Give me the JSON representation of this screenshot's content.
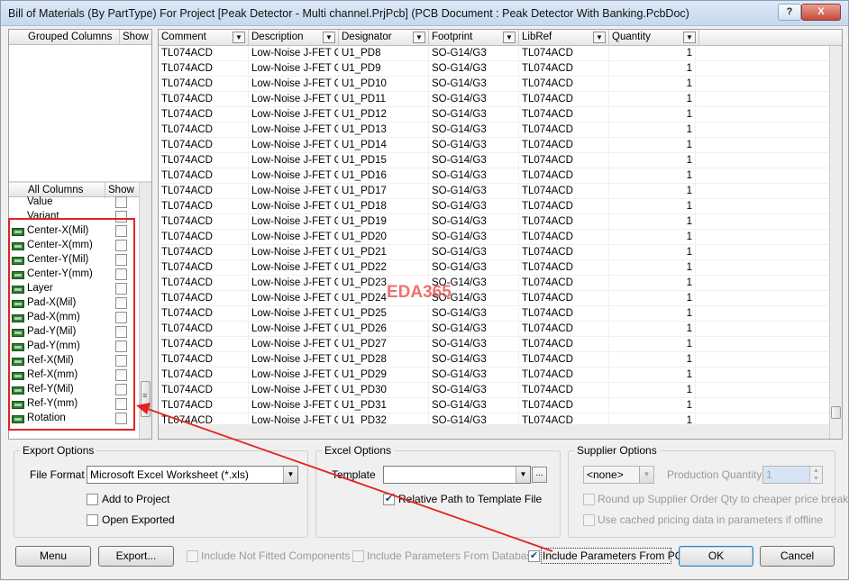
{
  "window": {
    "title": "Bill of Materials (By PartType) For Project [Peak Detector - Multi channel.PrjPcb] (PCB Document : Peak Detector With Banking.PcbDoc)",
    "help_label": "?",
    "close_label": "X"
  },
  "grouped_columns": {
    "headers": [
      "Grouped Columns",
      "Show"
    ]
  },
  "all_columns": {
    "headers": [
      "All Columns",
      "Show"
    ],
    "items": [
      {
        "label": "Value",
        "icon": "none",
        "checked": false
      },
      {
        "label": "Variant",
        "icon": "none",
        "checked": false
      },
      {
        "label": "Center-X(Mil)",
        "icon": "pcb-param-icon",
        "checked": false
      },
      {
        "label": "Center-X(mm)",
        "icon": "pcb-param-icon",
        "checked": false
      },
      {
        "label": "Center-Y(Mil)",
        "icon": "pcb-param-icon",
        "checked": false
      },
      {
        "label": "Center-Y(mm)",
        "icon": "pcb-param-icon",
        "checked": false
      },
      {
        "label": "Layer",
        "icon": "pcb-param-icon",
        "checked": false
      },
      {
        "label": "Pad-X(Mil)",
        "icon": "pcb-param-icon",
        "checked": false
      },
      {
        "label": "Pad-X(mm)",
        "icon": "pcb-param-icon",
        "checked": false
      },
      {
        "label": "Pad-Y(Mil)",
        "icon": "pcb-param-icon",
        "checked": false
      },
      {
        "label": "Pad-Y(mm)",
        "icon": "pcb-param-icon",
        "checked": false
      },
      {
        "label": "Ref-X(Mil)",
        "icon": "pcb-param-icon",
        "checked": false
      },
      {
        "label": "Ref-X(mm)",
        "icon": "pcb-param-icon",
        "checked": false
      },
      {
        "label": "Ref-Y(Mil)",
        "icon": "pcb-param-icon",
        "checked": false
      },
      {
        "label": "Ref-Y(mm)",
        "icon": "pcb-param-icon",
        "checked": false
      },
      {
        "label": "Rotation",
        "icon": "pcb-param-icon",
        "checked": false
      }
    ]
  },
  "grid": {
    "columns": [
      "Comment",
      "Description",
      "Designator",
      "Footprint",
      "LibRef",
      "Quantity"
    ],
    "rows": [
      [
        "TL074ACD",
        "Low-Noise J-FET Qu",
        "U1_PD8",
        "SO-G14/G3",
        "TL074ACD",
        "1"
      ],
      [
        "TL074ACD",
        "Low-Noise J-FET Qu",
        "U1_PD9",
        "SO-G14/G3",
        "TL074ACD",
        "1"
      ],
      [
        "TL074ACD",
        "Low-Noise J-FET Qu",
        "U1_PD10",
        "SO-G14/G3",
        "TL074ACD",
        "1"
      ],
      [
        "TL074ACD",
        "Low-Noise J-FET Qu",
        "U1_PD11",
        "SO-G14/G3",
        "TL074ACD",
        "1"
      ],
      [
        "TL074ACD",
        "Low-Noise J-FET Qu",
        "U1_PD12",
        "SO-G14/G3",
        "TL074ACD",
        "1"
      ],
      [
        "TL074ACD",
        "Low-Noise J-FET Qu",
        "U1_PD13",
        "SO-G14/G3",
        "TL074ACD",
        "1"
      ],
      [
        "TL074ACD",
        "Low-Noise J-FET Qu",
        "U1_PD14",
        "SO-G14/G3",
        "TL074ACD",
        "1"
      ],
      [
        "TL074ACD",
        "Low-Noise J-FET Qu",
        "U1_PD15",
        "SO-G14/G3",
        "TL074ACD",
        "1"
      ],
      [
        "TL074ACD",
        "Low-Noise J-FET Qu",
        "U1_PD16",
        "SO-G14/G3",
        "TL074ACD",
        "1"
      ],
      [
        "TL074ACD",
        "Low-Noise J-FET Qu",
        "U1_PD17",
        "SO-G14/G3",
        "TL074ACD",
        "1"
      ],
      [
        "TL074ACD",
        "Low-Noise J-FET Qu",
        "U1_PD18",
        "SO-G14/G3",
        "TL074ACD",
        "1"
      ],
      [
        "TL074ACD",
        "Low-Noise J-FET Qu",
        "U1_PD19",
        "SO-G14/G3",
        "TL074ACD",
        "1"
      ],
      [
        "TL074ACD",
        "Low-Noise J-FET Qu",
        "U1_PD20",
        "SO-G14/G3",
        "TL074ACD",
        "1"
      ],
      [
        "TL074ACD",
        "Low-Noise J-FET Qu",
        "U1_PD21",
        "SO-G14/G3",
        "TL074ACD",
        "1"
      ],
      [
        "TL074ACD",
        "Low-Noise J-FET Qu",
        "U1_PD22",
        "SO-G14/G3",
        "TL074ACD",
        "1"
      ],
      [
        "TL074ACD",
        "Low-Noise J-FET Qu",
        "U1_PD23",
        "SO-G14/G3",
        "TL074ACD",
        "1"
      ],
      [
        "TL074ACD",
        "Low-Noise J-FET Qu",
        "U1_PD24",
        "SO-G14/G3",
        "TL074ACD",
        "1"
      ],
      [
        "TL074ACD",
        "Low-Noise J-FET Qu",
        "U1_PD25",
        "SO-G14/G3",
        "TL074ACD",
        "1"
      ],
      [
        "TL074ACD",
        "Low-Noise J-FET Qu",
        "U1_PD26",
        "SO-G14/G3",
        "TL074ACD",
        "1"
      ],
      [
        "TL074ACD",
        "Low-Noise J-FET Qu",
        "U1_PD27",
        "SO-G14/G3",
        "TL074ACD",
        "1"
      ],
      [
        "TL074ACD",
        "Low-Noise J-FET Qu",
        "U1_PD28",
        "SO-G14/G3",
        "TL074ACD",
        "1"
      ],
      [
        "TL074ACD",
        "Low-Noise J-FET Qu",
        "U1_PD29",
        "SO-G14/G3",
        "TL074ACD",
        "1"
      ],
      [
        "TL074ACD",
        "Low-Noise J-FET Qu",
        "U1_PD30",
        "SO-G14/G3",
        "TL074ACD",
        "1"
      ],
      [
        "TL074ACD",
        "Low-Noise J-FET Qu",
        "U1_PD31",
        "SO-G14/G3",
        "TL074ACD",
        "1"
      ],
      [
        "TL074ACD",
        "Low-Noise J-FET Qu",
        "U1_PD32",
        "SO-G14/G3",
        "TL074ACD",
        "1"
      ]
    ]
  },
  "watermark": "EDA365",
  "export_options": {
    "title": "Export Options",
    "file_format_label": "File Format",
    "file_format_value": "Microsoft Excel Worksheet (*.xls)",
    "add_to_project_label": "Add to Project",
    "add_to_project_checked": false,
    "open_exported_label": "Open Exported",
    "open_exported_checked": false
  },
  "excel_options": {
    "title": "Excel Options",
    "template_label": "Template",
    "template_value": "",
    "ellipsis_label": "...",
    "relative_path_label": "Relative Path to Template File",
    "relative_path_checked": true
  },
  "supplier_options": {
    "title": "Supplier Options",
    "supplier_value": "<none>",
    "production_qty_label": "Production Quantity",
    "production_qty_value": "1",
    "round_up_label": "Round up Supplier Order Qty to cheaper price break",
    "round_up_checked": false,
    "cached_pricing_label": "Use cached pricing data in parameters if offline",
    "cached_pricing_checked": false
  },
  "footer": {
    "menu_label": "Menu",
    "export_label": "Export...",
    "include_not_fitted_label": "Include Not Fitted Components",
    "include_not_fitted_checked": false,
    "include_db_params_label": "Include Parameters From Database",
    "include_db_params_checked": false,
    "include_pcb_params_label": "Include Parameters From PCB",
    "include_pcb_params_checked": true,
    "ok_label": "OK",
    "cancel_label": "Cancel"
  },
  "colors": {
    "annotation_red": "#e02424",
    "watermark": "#ea5a5a",
    "pcb_icon_green": "#2e7d32"
  }
}
